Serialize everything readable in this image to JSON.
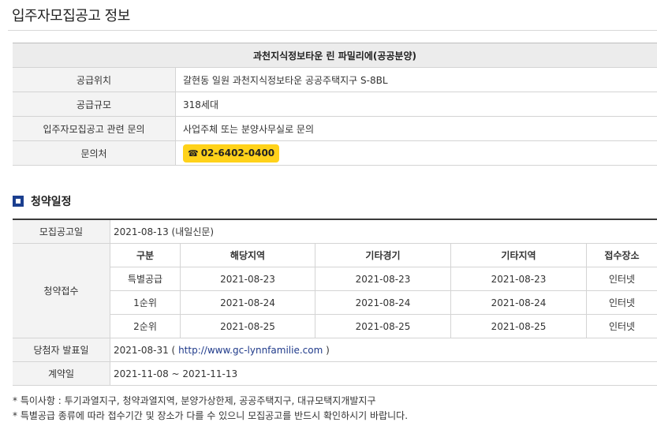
{
  "page_title": "입주자모집공고 정보",
  "info": {
    "complex_name": "과천지식정보타운 린 파밀리에(공공분양)",
    "rows": [
      {
        "label": "공급위치",
        "value": "갈현동 일원 과천지식정보타운 공공주택지구 S-8BL"
      },
      {
        "label": "공급규모",
        "value": "318세대"
      },
      {
        "label": "입주자모집공고 관련 문의",
        "value": "사업주체 또는 분양사무실로 문의"
      }
    ],
    "contact_label": "문의처",
    "phone": "02-6402-0400",
    "phone_glyph": "☎"
  },
  "schedule": {
    "section_title": "청약일정",
    "announce_label": "모집공고일",
    "announce_value": "2021-08-13 (내일신문)",
    "receipt_label": "청약접수",
    "columns": [
      "구분",
      "해당지역",
      "기타경기",
      "기타지역",
      "접수장소"
    ],
    "rows": [
      [
        "특별공급",
        "2021-08-23",
        "2021-08-23",
        "2021-08-23",
        "인터넷"
      ],
      [
        "1순위",
        "2021-08-24",
        "2021-08-24",
        "2021-08-24",
        "인터넷"
      ],
      [
        "2순위",
        "2021-08-25",
        "2021-08-25",
        "2021-08-25",
        "인터넷"
      ]
    ],
    "winner_label": "당첨자 발표일",
    "winner_date": "2021-08-31 (",
    "winner_link": "http://www.gc-lynnfamilie.com",
    "winner_close": ")",
    "contract_label": "계약일",
    "contract_value": "2021-11-08 ~ 2021-11-13"
  },
  "notes": [
    "* 특이사항 : 투기과열지구, 청약과열지역, 분양가상한제, 공공주택지구, 대규모택지개발지구",
    "* 특별공급 종류에 따라 접수기간 및 장소가 다를 수 있으니 모집공고를 반드시 확인하시기 바랍니다."
  ],
  "colors": {
    "accent": "#1b3f8f",
    "phone_bg": "#ffd21a",
    "link": "#1f3a8a"
  }
}
